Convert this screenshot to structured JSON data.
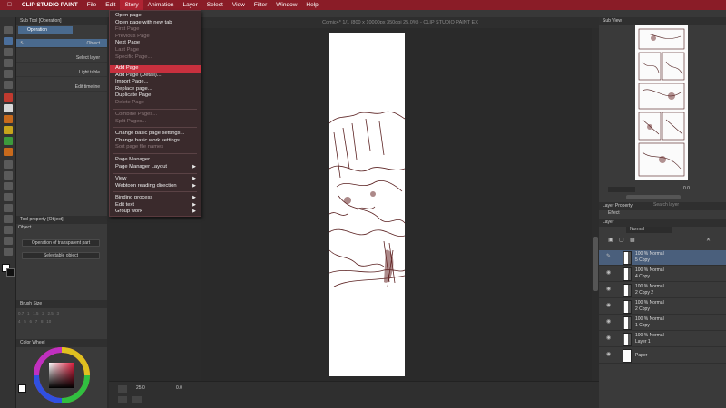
{
  "menubar": {
    "items": [
      "CLIP STUDIO PAINT",
      "File",
      "Edit",
      "Story",
      "Animation",
      "Layer",
      "Select",
      "View",
      "Filter",
      "Window",
      "Help"
    ],
    "active": "Story"
  },
  "window_title": "Comic4* 1/1 (800 x 10000px 350dpi 25.0%) - CLIP STUDIO PAINT EX",
  "story_menu": [
    {
      "label": "Open page",
      "enabled": true
    },
    {
      "label": "Open page with new tab",
      "enabled": true
    },
    {
      "label": "First Page",
      "enabled": false
    },
    {
      "label": "Previous Page",
      "enabled": false
    },
    {
      "label": "Next Page",
      "enabled": true
    },
    {
      "label": "Last Page",
      "enabled": false
    },
    {
      "label": "Specific Page...",
      "enabled": false
    },
    {
      "label": "Add Page",
      "enabled": true,
      "selected": true
    },
    {
      "label": "Add Page (Detail)...",
      "enabled": true
    },
    {
      "label": "Import Page...",
      "enabled": true
    },
    {
      "label": "Replace page...",
      "enabled": true
    },
    {
      "label": "Duplicate Page",
      "enabled": true
    },
    {
      "label": "Delete Page",
      "enabled": false
    },
    {
      "label": "Combine Pages...",
      "enabled": false
    },
    {
      "label": "Split Pages...",
      "enabled": false
    },
    {
      "label": "Change basic page settings...",
      "enabled": true
    },
    {
      "label": "Change basic work settings...",
      "enabled": true
    },
    {
      "label": "Sort page file names",
      "enabled": false
    },
    {
      "label": "Page Manager",
      "enabled": true
    },
    {
      "label": "Page Manager Layout",
      "enabled": true,
      "submenu": true
    },
    {
      "label": "View",
      "enabled": true,
      "submenu": true
    },
    {
      "label": "Webtoon reading direction",
      "enabled": true,
      "submenu": true
    },
    {
      "label": "Binding process",
      "enabled": true,
      "submenu": true
    },
    {
      "label": "Edit text",
      "enabled": true,
      "submenu": true
    },
    {
      "label": "Group work",
      "enabled": true,
      "submenu": true
    }
  ],
  "left_panel": {
    "subtool_header": "Sub Tool [Operation]",
    "operation_tab": "Operation",
    "rows": [
      {
        "label": "Object"
      },
      {
        "label": "Select layer"
      },
      {
        "label": "Light table"
      },
      {
        "label": "Edit timeline"
      }
    ],
    "tool_property_header": "Tool property [Object]",
    "tool_property_label": "Object",
    "dropdown1": "Operation of transparent part",
    "dropdown2": "Selectable object",
    "brush_size_header": "Brush Size",
    "color_wheel_header": "Color Wheel"
  },
  "right_panel": {
    "subview_header": "Sub View",
    "zoom_value": "0.0",
    "layer_property_header": "Layer Property",
    "search_layer": "Search layer",
    "effect_label": "Effect",
    "layer_header": "Layer",
    "blend_mode": "Normal",
    "layers": [
      {
        "opacity": "100 % Normal",
        "name": "5 Copy",
        "selected": true
      },
      {
        "opacity": "100 % Normal",
        "name": "4 Copy"
      },
      {
        "opacity": "100 % Normal",
        "name": "2 Copy 2"
      },
      {
        "opacity": "100 % Normal",
        "name": "2 Copy"
      },
      {
        "opacity": "100 % Normal",
        "name": "1 Copy"
      },
      {
        "opacity": "100 % Normal",
        "name": "Layer 1"
      },
      {
        "opacity": "",
        "name": "Paper"
      }
    ]
  },
  "status": {
    "zoom": "25.0",
    "angle": "0.0"
  },
  "colors": {
    "menubar_bg": "#8a1c27",
    "menu_selected": "#c8303e",
    "panel_bg": "#3a3a3a",
    "canvas_bg": "#2a2a2a"
  }
}
